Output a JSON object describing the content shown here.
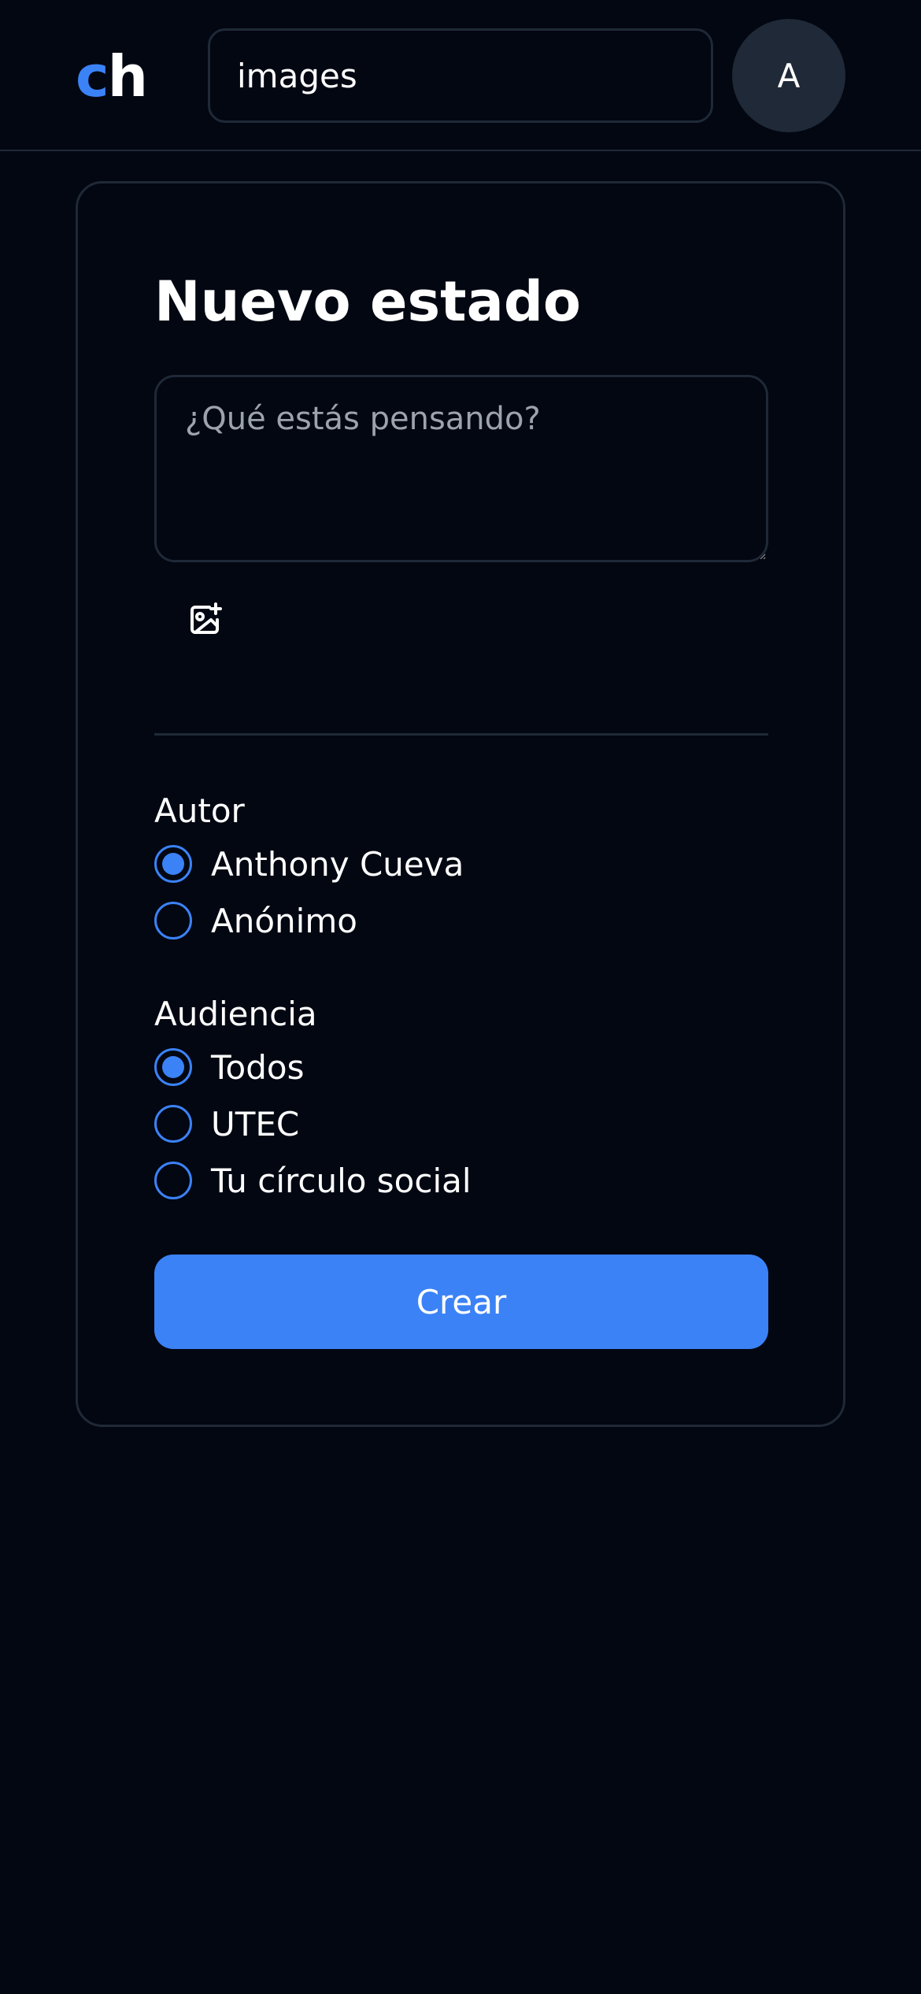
{
  "header": {
    "logo": {
      "first": "c",
      "second": "h"
    },
    "search": {
      "value": "images"
    },
    "avatar": {
      "initial": "A"
    }
  },
  "form": {
    "title": "Nuevo estado",
    "status": {
      "placeholder": "¿Qué estás pensando?",
      "value": ""
    },
    "image_icon": "image-plus-icon",
    "author": {
      "label": "Autor",
      "options": [
        {
          "label": "Anthony Cueva",
          "selected": true
        },
        {
          "label": "Anónimo",
          "selected": false
        }
      ]
    },
    "audience": {
      "label": "Audiencia",
      "options": [
        {
          "label": "Todos",
          "selected": true
        },
        {
          "label": "UTEC",
          "selected": false
        },
        {
          "label": "Tu círculo social",
          "selected": false
        }
      ]
    },
    "submit_label": "Crear"
  },
  "colors": {
    "background": "#030712",
    "border": "#1f2937",
    "accent": "#3b82f6",
    "placeholder": "#9ca3af",
    "avatar_bg": "#1f2937"
  }
}
